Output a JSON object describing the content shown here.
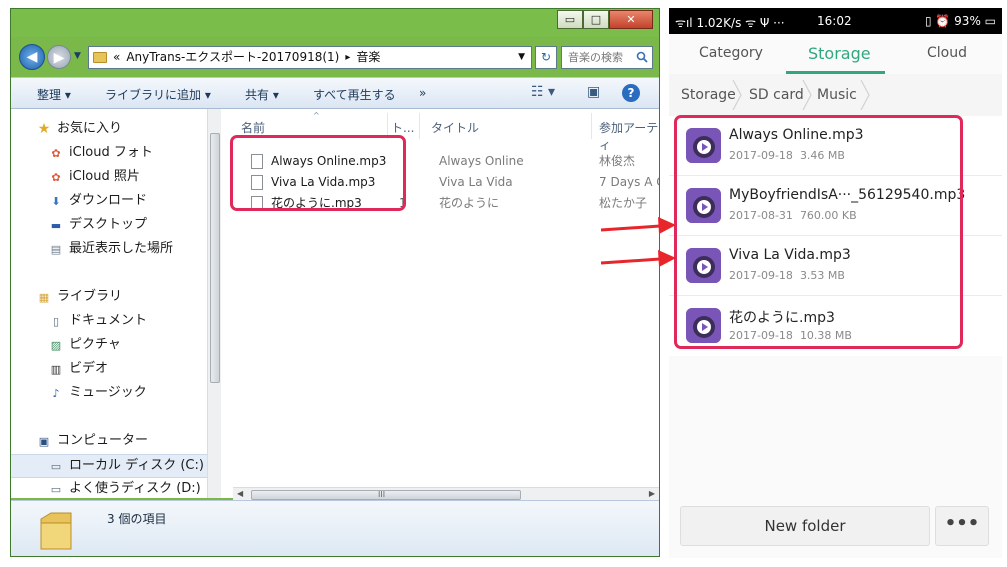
{
  "explorer": {
    "window_buttons": {
      "minimize": "▭",
      "maximize": "□",
      "close": "✕"
    },
    "address": {
      "prefix": "«",
      "folder": "AnyTrans-エクスポート-20170918(1)",
      "separator": "▸",
      "current": "音楽"
    },
    "search_placeholder": "音楽の検索",
    "toolbar": {
      "organize": "整理 ▾",
      "add_to_library": "ライブラリに追加 ▾",
      "share": "共有 ▾",
      "play_all": "すべて再生する",
      "more": "»",
      "help": "?"
    },
    "nav": {
      "favorites": "お気に入り",
      "icloud_photos": "iCloud フォト",
      "icloud_shared": "iCloud 照片",
      "downloads": "ダウンロード",
      "desktop": "デスクトップ",
      "recent": "最近表示した場所",
      "libraries": "ライブラリ",
      "documents": "ドキュメント",
      "pictures": "ピクチャ",
      "videos": "ビデオ",
      "music": "ミュージック",
      "computer": "コンピューター",
      "local_disk": "ローカル ディスク (C:)",
      "fav_disk": "よく使うディスク (D:)"
    },
    "columns": {
      "name": "名前",
      "track": "ト...",
      "title": "タイトル",
      "artist": "参加アーティ"
    },
    "files": [
      {
        "name": "Always Online.mp3",
        "track": "",
        "title": "Always Online",
        "artist": "林俊杰"
      },
      {
        "name": "Viva La Vida.mp3",
        "track": "",
        "title": "Viva La Vida",
        "artist": "7 Days A C"
      },
      {
        "name": "花のように.mp3",
        "track": "1",
        "title": "花のように",
        "artist": "松たか子"
      }
    ],
    "status_text": "3 個の項目",
    "hscroll_grip": "III"
  },
  "phone": {
    "statusbar": {
      "left": "ᯤıl 1.02K/s ᯤ Ψ ···",
      "time": "16:02",
      "right": "▯ ⏰ 93% ▭"
    },
    "tabs": {
      "category": "Category",
      "storage": "Storage",
      "cloud": "Cloud"
    },
    "breadcrumb": {
      "storage": "Storage",
      "sdcard": "SD card",
      "music": "Music"
    },
    "files": [
      {
        "name": "Always Online.mp3",
        "date": "2017-09-18",
        "size": "3.46 MB"
      },
      {
        "name": "MyBoyfriendIsA···_56129540.mp3",
        "date": "2017-08-31",
        "size": "760.00 KB"
      },
      {
        "name": "Viva La Vida.mp3",
        "date": "2017-09-18",
        "size": "3.53 MB"
      },
      {
        "name": "花のように.mp3",
        "date": "2017-09-18",
        "size": "10.38 MB"
      }
    ],
    "new_folder": "New folder",
    "more": "•••"
  },
  "colors": {
    "highlight": "#e0285a",
    "arrow": "#e8252a",
    "accent": "#2fa87e",
    "window_frame": "#79b849"
  }
}
